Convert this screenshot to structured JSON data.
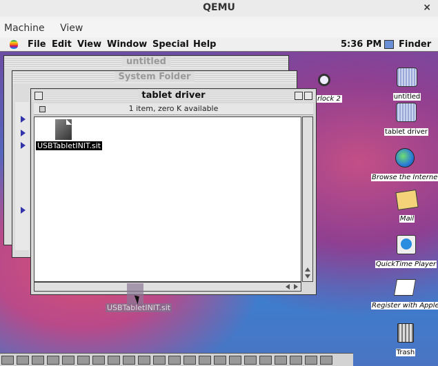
{
  "host": {
    "title": "QEMU",
    "close": "×",
    "menu": [
      "Machine",
      "View"
    ]
  },
  "mac_menu": {
    "items": [
      "File",
      "Edit",
      "View",
      "Window",
      "Special",
      "Help"
    ],
    "clock": "5:36 PM",
    "app": "Finder"
  },
  "windows": {
    "untitled": {
      "title": "untitled"
    },
    "system_folder": {
      "title": "System Folder"
    },
    "tablet_driver": {
      "title": "tablet driver",
      "info": "1 item, zero K available",
      "file": "USBTabletINIT.sit"
    }
  },
  "behind_text": {
    "a": "rlock 2"
  },
  "desktop": {
    "items": [
      "untitled",
      "tablet driver",
      "Browse the Internet",
      "Mail",
      "QuickTime Player",
      "Register with Apple",
      "Trash"
    ],
    "dragging": "USBTabletINIT.sit"
  }
}
